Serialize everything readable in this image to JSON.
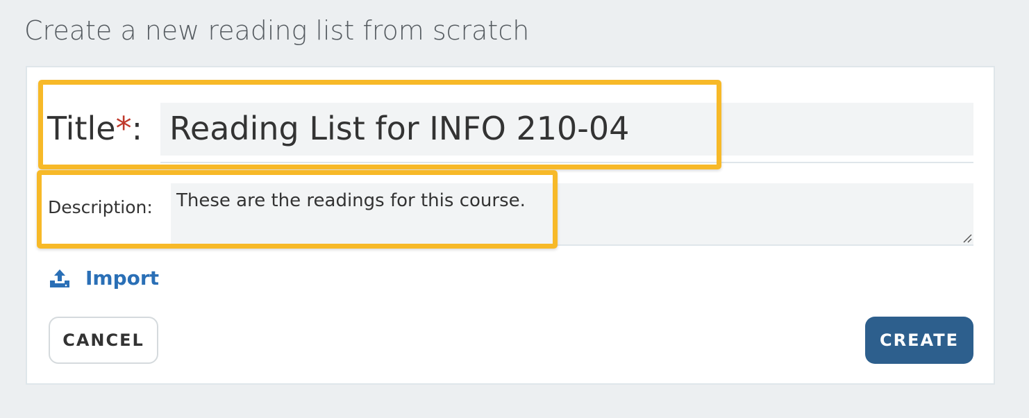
{
  "page": {
    "heading": "Create a new reading list from scratch"
  },
  "form": {
    "title_label": "Title",
    "required_mark": "*",
    "title_colon": ":",
    "title_value": "Reading List for INFO 210-04",
    "description_label": "Description:",
    "description_value": "These are the readings for this course."
  },
  "actions": {
    "import_label": "Import",
    "cancel_label": "CANCEL",
    "create_label": "CREATE"
  },
  "colors": {
    "highlight": "#f7b928",
    "primary_button": "#2d5f8d",
    "link": "#2a6fb6",
    "required": "#c0392b",
    "background": "#eceff1"
  },
  "icons": {
    "import": "upload-icon",
    "resize": "resize-grip-icon"
  }
}
